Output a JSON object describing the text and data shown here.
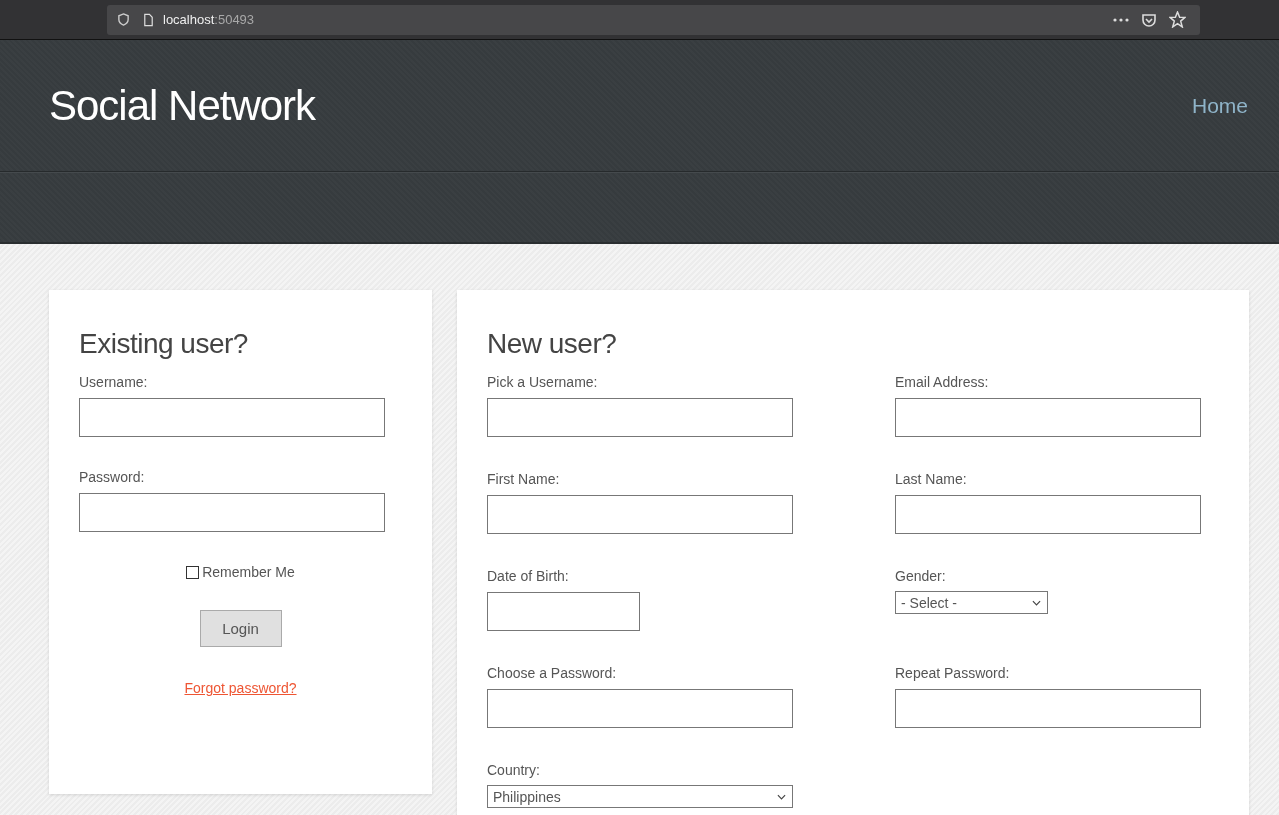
{
  "browser": {
    "host": "localhost",
    "port": ":50493"
  },
  "header": {
    "title": "Social Network",
    "nav": [
      {
        "label": "Home"
      }
    ]
  },
  "login": {
    "heading": "Existing user?",
    "fields": [
      {
        "label": "Username:"
      },
      {
        "label": "Password:"
      }
    ],
    "remember": {
      "label": "Remember Me",
      "checked": false
    },
    "button": "Login",
    "link": "Forgot password?"
  },
  "register": {
    "heading": "New user?",
    "fields": [
      {
        "label": "Pick a Username:",
        "kind": "text"
      },
      {
        "label": "Email Address:",
        "kind": "text"
      },
      {
        "label": "First Name:",
        "kind": "text"
      },
      {
        "label": "Last Name:",
        "kind": "text"
      },
      {
        "label": "Date of Birth:",
        "kind": "date"
      },
      {
        "label": "Gender:",
        "kind": "select",
        "value": "- Select -"
      },
      {
        "label": "Choose a Password:",
        "kind": "text"
      },
      {
        "label": "Repeat Password:",
        "kind": "text"
      },
      {
        "label": "Country:",
        "kind": "select-wide",
        "value": "Philippines"
      }
    ]
  }
}
